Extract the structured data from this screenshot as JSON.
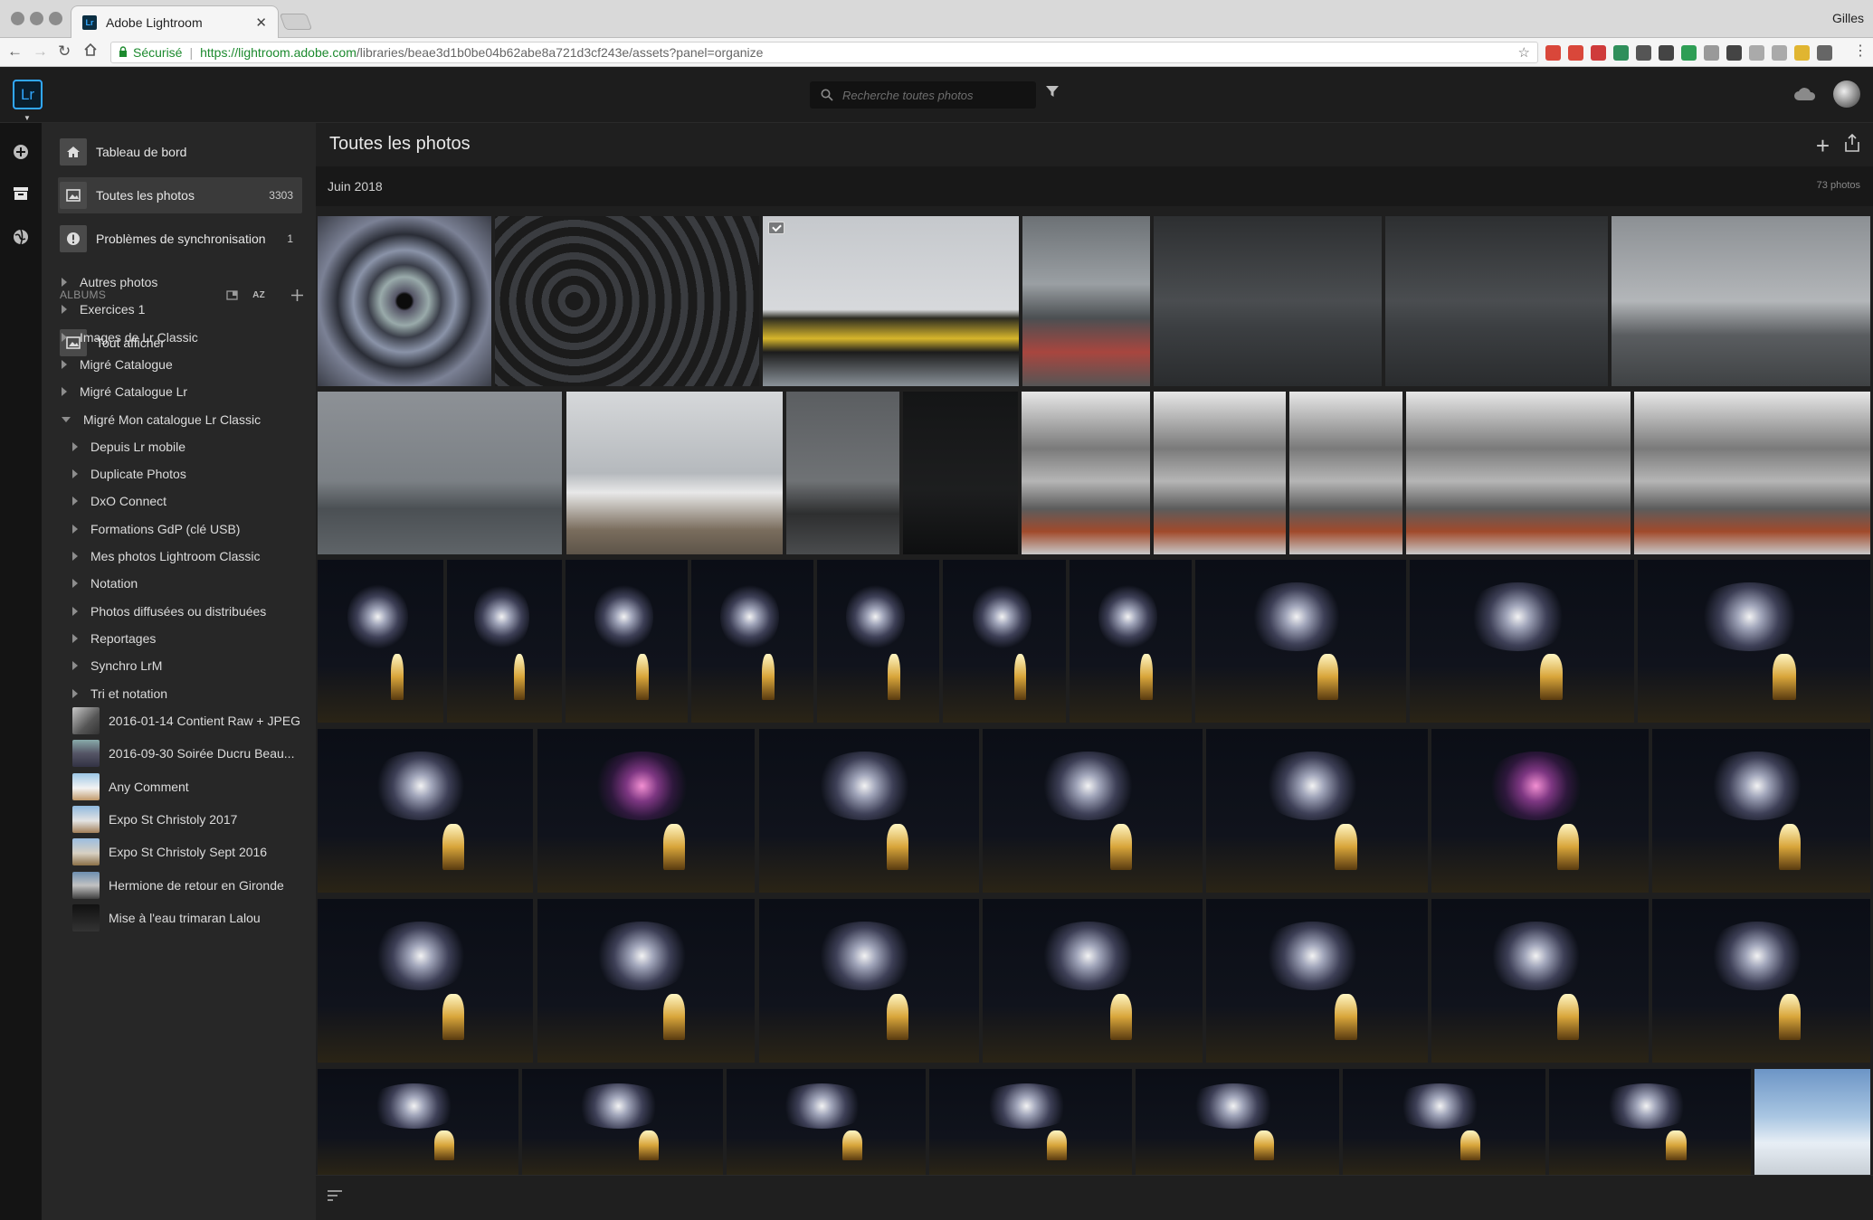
{
  "browser": {
    "tab_title": "Adobe Lightroom",
    "tab_favicon": "Lr",
    "user": "Gilles",
    "url": {
      "secure_label": "Sécurisé",
      "host": "https://lightroom.adobe.com",
      "path": "/libraries/beae3d1b0be04b62abe8a721d3cf243e/assets?panel=organize"
    },
    "extension_colors": [
      "#d9473a",
      "#d9473a",
      "#cf3b3b",
      "#2f8f5b",
      "#555555",
      "#444444",
      "#2e9e55",
      "#999999",
      "#444444",
      "#aaaaaa",
      "#aaaaaa",
      "#e0b531",
      "#666666"
    ]
  },
  "app": {
    "logo": "Lr",
    "search_placeholder": "Recherche toutes photos"
  },
  "nav": {
    "dashboard": "Tableau de bord",
    "all_photos": "Toutes les photos",
    "all_photos_count": "3303",
    "sync_problems": "Problèmes de synchronisation",
    "sync_count": "1"
  },
  "albums": {
    "header": "ALBUMS",
    "sort_label": "AZ",
    "show_all": "Tout afficher",
    "items": [
      {
        "label": "Autres photos",
        "level": 0,
        "kind": "folder"
      },
      {
        "label": "Exercices 1",
        "level": 0,
        "kind": "folder"
      },
      {
        "label": "Images de Lr Classic",
        "level": 0,
        "kind": "folder"
      },
      {
        "label": "Migré Catalogue",
        "level": 0,
        "kind": "folder"
      },
      {
        "label": "Migré Catalogue Lr",
        "level": 0,
        "kind": "folder"
      },
      {
        "label": "Migré Mon catalogue Lr Classic",
        "level": 0,
        "kind": "folder-open"
      },
      {
        "label": "Depuis Lr mobile",
        "level": 1,
        "kind": "folder"
      },
      {
        "label": "Duplicate Photos",
        "level": 1,
        "kind": "folder"
      },
      {
        "label": "DxO Connect",
        "level": 1,
        "kind": "folder"
      },
      {
        "label": "Formations GdP (clé USB)",
        "level": 1,
        "kind": "folder"
      },
      {
        "label": "Mes photos Lightroom Classic",
        "level": 1,
        "kind": "folder"
      },
      {
        "label": "Notation",
        "level": 1,
        "kind": "folder"
      },
      {
        "label": "Photos diffusées ou distribuées",
        "level": 1,
        "kind": "folder"
      },
      {
        "label": "Reportages",
        "level": 1,
        "kind": "folder"
      },
      {
        "label": "Synchro LrM",
        "level": 1,
        "kind": "folder"
      },
      {
        "label": "Tri et notation",
        "level": 1,
        "kind": "folder"
      },
      {
        "label": "2016-01-14 Contient Raw + JPEG",
        "level": 1,
        "kind": "album"
      },
      {
        "label": "2016-09-30 Soirée Ducru Beau...",
        "level": 1,
        "kind": "album"
      },
      {
        "label": "Any Comment",
        "level": 1,
        "kind": "album"
      },
      {
        "label": "Expo St Christoly 2017",
        "level": 1,
        "kind": "album"
      },
      {
        "label": "Expo St Christoly Sept 2016",
        "level": 1,
        "kind": "album"
      },
      {
        "label": "Hermione de retour en Gironde",
        "level": 1,
        "kind": "album"
      },
      {
        "label": "Mise à l'eau trimaran Lalou",
        "level": 1,
        "kind": "album"
      }
    ]
  },
  "main": {
    "title": "Toutes les photos",
    "date_header": "Juin 2018",
    "photo_count": "73 photos"
  }
}
